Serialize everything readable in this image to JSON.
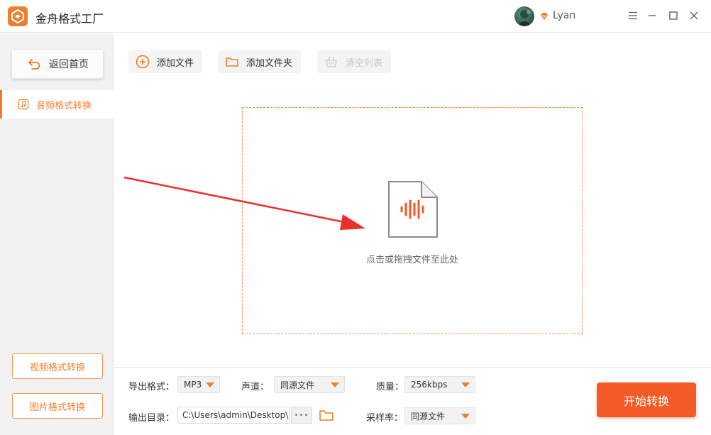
{
  "app": {
    "title": "金舟格式工厂"
  },
  "user": {
    "name": "Lyan"
  },
  "sidebar": {
    "home_label": "返回首页",
    "active_item": "音频格式转换",
    "video_btn": "视频格式转换",
    "image_btn": "图片格式转换"
  },
  "toolbar": {
    "add_file": "添加文件",
    "add_folder": "添加文件夹",
    "clear_list": "清空列表"
  },
  "dropzone": {
    "hint": "点击或拖拽文件至此处"
  },
  "settings": {
    "export_format_label": "导出格式：",
    "export_format_value": "MP3",
    "channel_label": "声道：",
    "channel_value": "同源文件",
    "quality_label": "质量：",
    "quality_value": "256kbps",
    "output_dir_label": "输出目录：",
    "output_dir_value": "C:\\Users\\admin\\Desktop\\",
    "sample_rate_label": "采样率：",
    "sample_rate_value": "同源文件",
    "more_glyph": "•••"
  },
  "actions": {
    "start": "开始转换"
  },
  "colors": {
    "accent": "#f47b25",
    "start_button": "#f35a26",
    "dropzone_border": "#f08a4b",
    "arrow": "#e8312a"
  }
}
